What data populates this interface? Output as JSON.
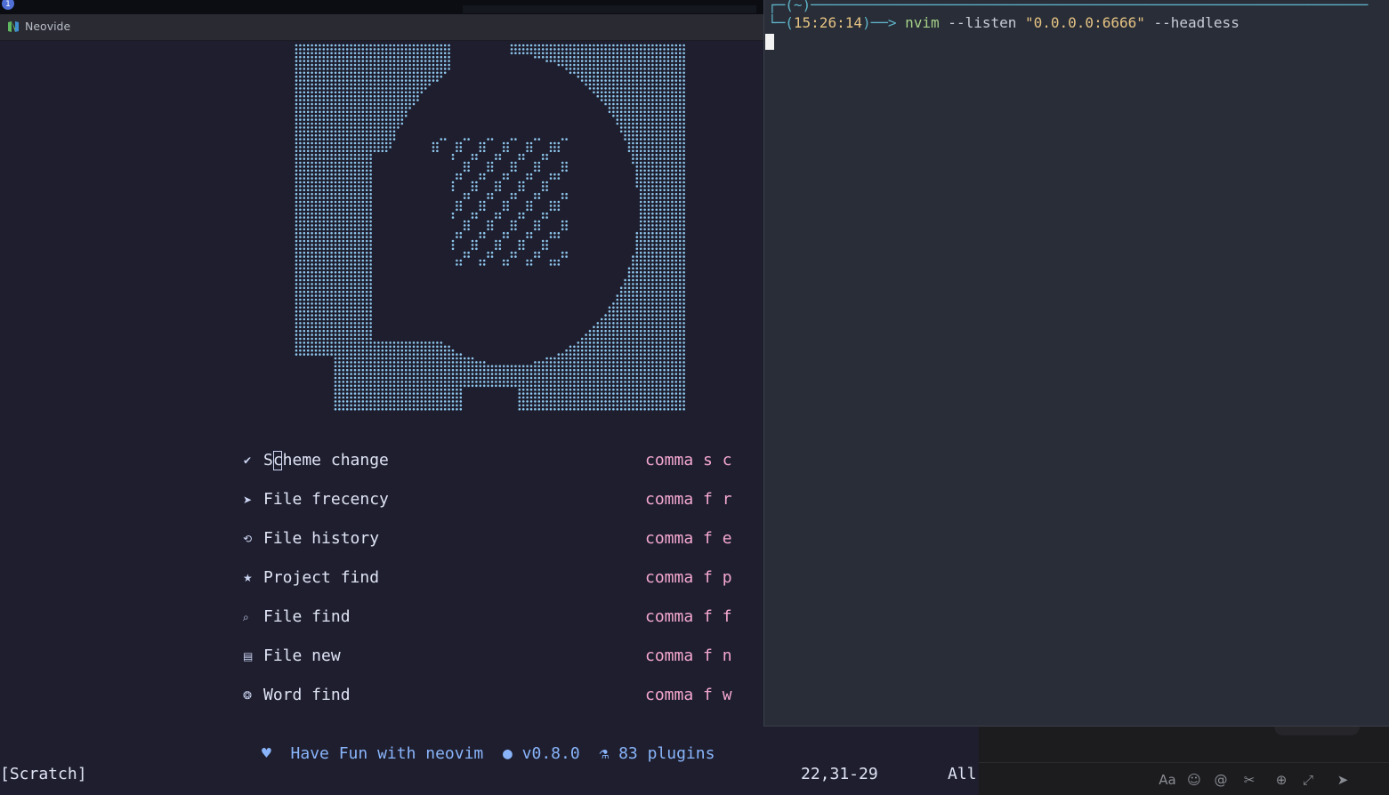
{
  "top_badge": "1",
  "neovide": {
    "title": "Neovide",
    "accent": "#89b4fa",
    "menu": [
      {
        "icon": "pen-icon",
        "glyph": "✔",
        "label": "Scheme change",
        "keys": "comma s c"
      },
      {
        "icon": "rocket-icon",
        "glyph": "➤",
        "label": "File frecency",
        "keys": "comma f r"
      },
      {
        "icon": "history-icon",
        "glyph": "⟲",
        "label": "File history",
        "keys": "comma f e"
      },
      {
        "icon": "bookmark-icon",
        "glyph": "★",
        "label": "Project find",
        "keys": "comma f p"
      },
      {
        "icon": "file-search-icon",
        "glyph": "⌕",
        "label": "File find",
        "keys": "comma f f"
      },
      {
        "icon": "file-new-icon",
        "glyph": "▤",
        "label": "File new",
        "keys": "comma f n"
      },
      {
        "icon": "word-find-icon",
        "glyph": "❂",
        "label": "Word find",
        "keys": "comma f w"
      }
    ],
    "footer": {
      "heart_icon": "♥",
      "fun": "Have Fun with neovim",
      "info_icon": "●",
      "version": "v0.8.0",
      "flask_icon": "⚗",
      "plugins": "83 plugins"
    },
    "status": {
      "buffer": "[Scratch]",
      "position": "22,31-29",
      "scroll": "All"
    }
  },
  "terminal": {
    "prompt_top": "┌─(~)─────────────────────────────────────────────────────────────────",
    "prompt_corner": "└─(",
    "time": "15:26:14",
    "prompt_arrow": ")──> ",
    "command": "nvim",
    "arg1": " --listen ",
    "arg_str": "\"0.0.0.0:6666\"",
    "arg2": " --headless"
  },
  "chat_tools": [
    {
      "icon": "font-icon",
      "glyph": "Aa"
    },
    {
      "icon": "emoji-icon",
      "glyph": "☺"
    },
    {
      "icon": "mention-icon",
      "glyph": "@"
    },
    {
      "icon": "scissors-icon",
      "glyph": "✂"
    },
    {
      "icon": "plus-circle-icon",
      "glyph": "⊕"
    },
    {
      "icon": "expand-icon",
      "glyph": "⤢"
    },
    {
      "icon": "send-icon",
      "glyph": "➤"
    }
  ]
}
